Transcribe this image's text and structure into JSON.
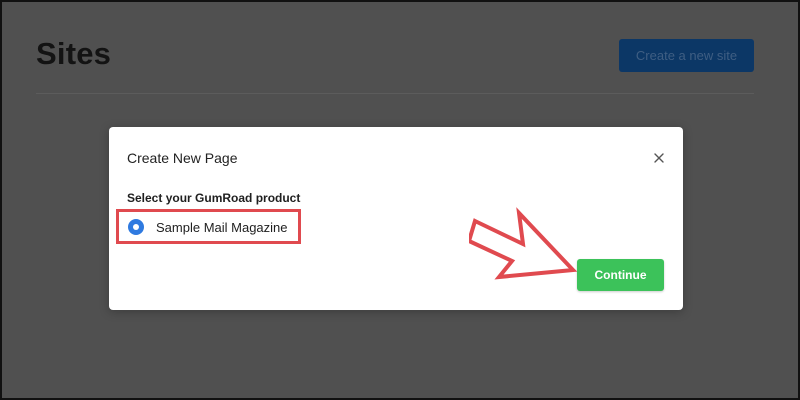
{
  "page": {
    "title": "Sites",
    "create_button_label": "Create a new site"
  },
  "modal": {
    "title": "Create New Page",
    "close_icon": "close-icon",
    "field_label": "Select your GumRoad product",
    "options": [
      {
        "label": "Sample Mail Magazine",
        "selected": true
      }
    ],
    "continue_label": "Continue"
  },
  "annotations": {
    "highlight_color": "#e04a4f",
    "arrow_icon": "pointing-arrow-icon"
  },
  "colors": {
    "accent_blue": "#2f7ae0",
    "continue_green": "#3cc25a",
    "overlay": "#505050"
  }
}
